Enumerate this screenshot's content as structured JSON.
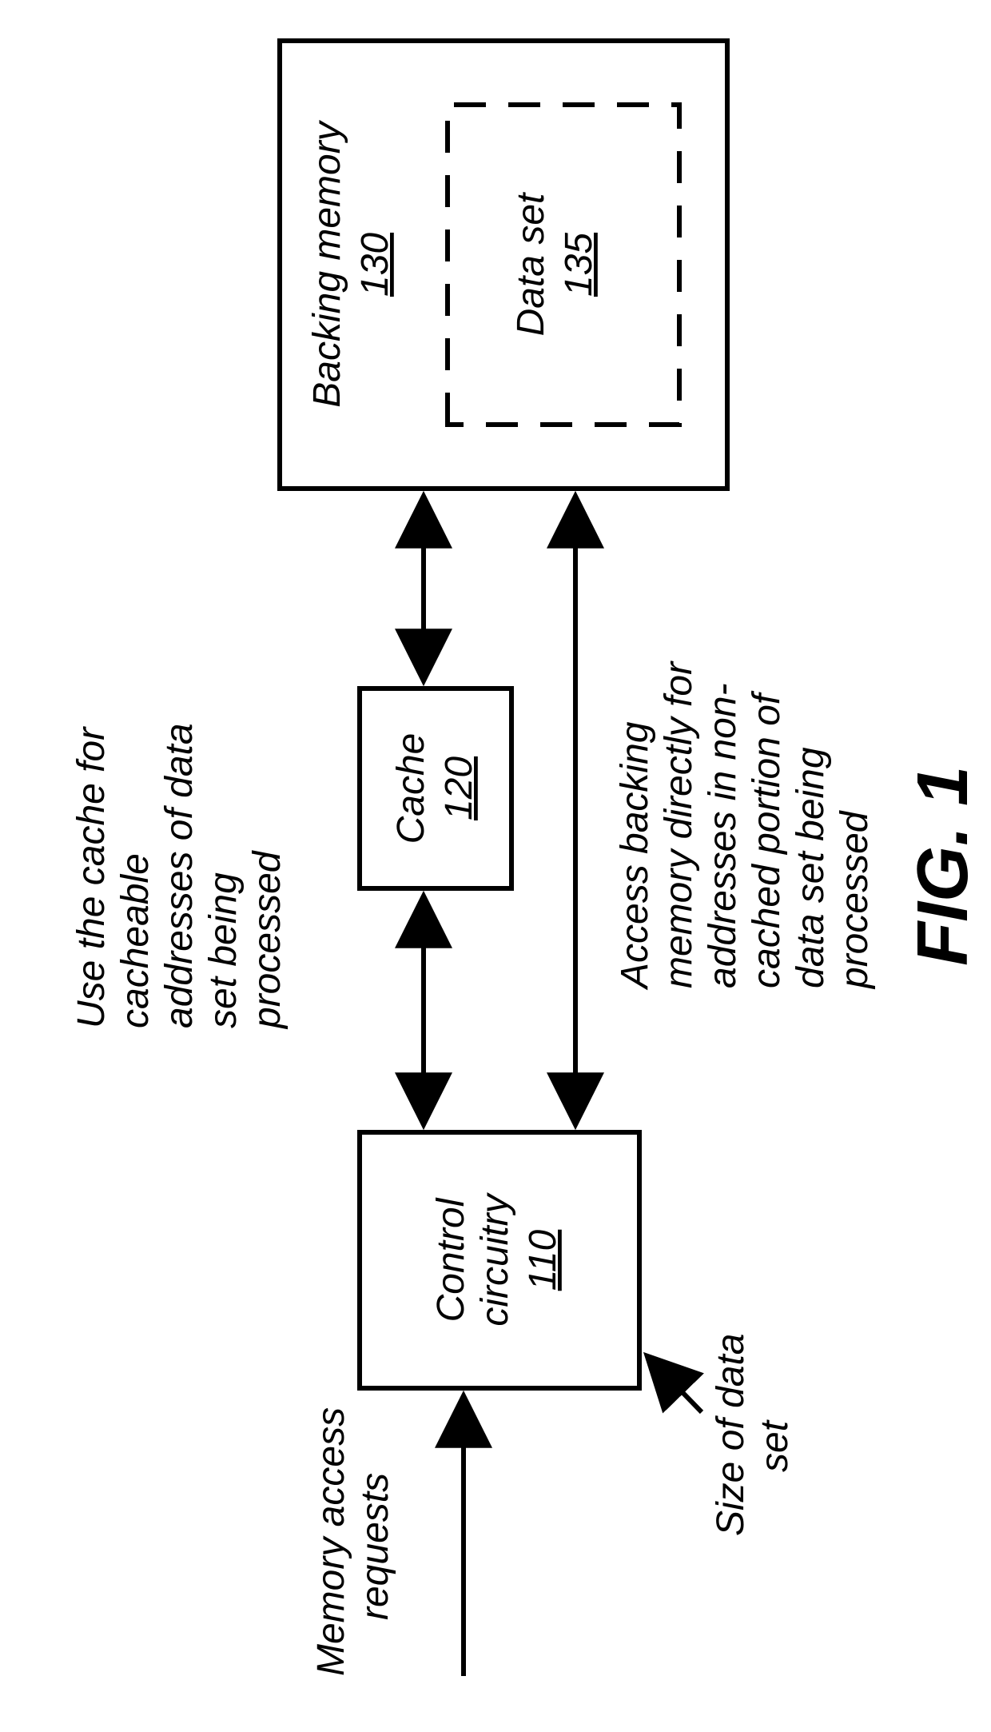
{
  "figure_label": "FIG. 1",
  "inputs": {
    "memory_access": {
      "l1": "Memory access",
      "l2": "requests"
    },
    "size_of_data_set": {
      "l1": "Size of data",
      "l2": "set"
    }
  },
  "blocks": {
    "control": {
      "title": "Control",
      "subtitle": "circuitry",
      "ref": "110"
    },
    "cache": {
      "title": "Cache",
      "ref": "120"
    },
    "memory": {
      "title": "Backing memory",
      "ref": "130"
    },
    "dataset": {
      "title": "Data set",
      "ref": "135"
    }
  },
  "annotations": {
    "use_cache": {
      "l1": "Use the cache for",
      "l2": "cacheable",
      "l3": "addresses of data",
      "l4": "set being",
      "l5": "processed"
    },
    "access_backing": {
      "l1": "Access backing",
      "l2": "memory directly for",
      "l3": "addresses in non-",
      "l4": "cached portion of",
      "l5": "data set being",
      "l6": "processed"
    }
  }
}
